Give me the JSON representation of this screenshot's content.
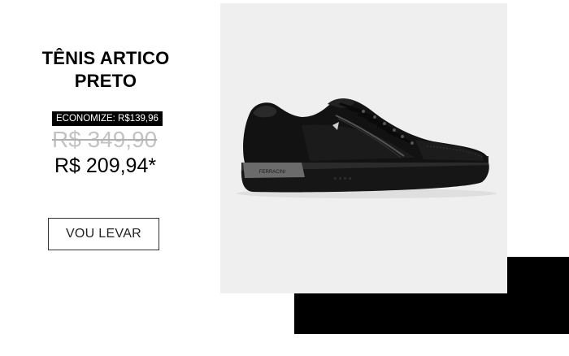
{
  "product": {
    "title": "TÊNIS ARTICO PRETO",
    "savings_label": "ECONOMIZE: R$139,96",
    "old_price": "R$ 349,90",
    "new_price": "R$ 209,94*",
    "cta_label": "VOU LEVAR",
    "image_alt": "black-sneaker",
    "brand_mark": "FERRACINI"
  },
  "colors": {
    "background": "#ffffff",
    "panel": "#efefef",
    "accent_block": "#000000",
    "old_price": "#c3c3c3"
  }
}
